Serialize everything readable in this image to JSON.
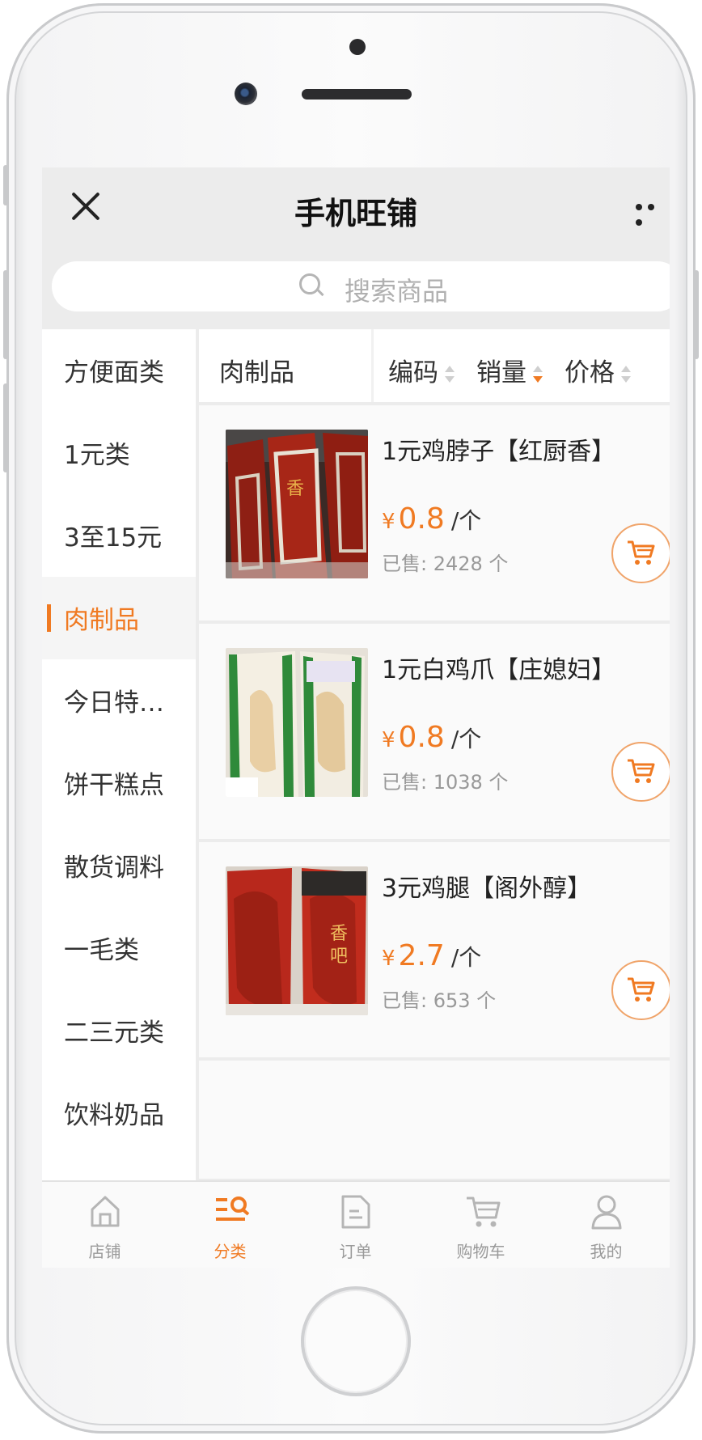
{
  "topbar": {
    "title": "手机旺铺"
  },
  "search": {
    "placeholder": "搜索商品"
  },
  "categories": [
    {
      "label": "方便面类",
      "active": false
    },
    {
      "label": "1元类",
      "active": false
    },
    {
      "label": "3至15元",
      "active": false
    },
    {
      "label": "肉制品",
      "active": true
    },
    {
      "label": "今日特…",
      "active": false
    },
    {
      "label": "饼干糕点",
      "active": false
    },
    {
      "label": "散货调料",
      "active": false
    },
    {
      "label": "一毛类",
      "active": false
    },
    {
      "label": "二三元类",
      "active": false
    },
    {
      "label": "饮料奶品",
      "active": false
    }
  ],
  "list_header": {
    "current_category": "肉制品",
    "sort": [
      {
        "label": "编码",
        "state": "none"
      },
      {
        "label": "销量",
        "state": "desc"
      },
      {
        "label": "价格",
        "state": "none"
      }
    ]
  },
  "products": [
    {
      "name": "1元鸡脖子【红厨香】",
      "currency": "¥",
      "price": "0.8",
      "unit": "/个",
      "sold": "已售: 2428 个"
    },
    {
      "name": "1元白鸡爪【庄媳妇】",
      "currency": "¥",
      "price": "0.8",
      "unit": "/个",
      "sold": "已售: 1038 个"
    },
    {
      "name": "3元鸡腿【阁外醇】",
      "currency": "¥",
      "price": "2.7",
      "unit": "/个",
      "sold": "已售: 653 个"
    }
  ],
  "tabs": [
    {
      "label": "店铺",
      "icon": "home-icon",
      "active": false
    },
    {
      "label": "分类",
      "icon": "category-icon",
      "active": true
    },
    {
      "label": "订单",
      "icon": "order-icon",
      "active": false
    },
    {
      "label": "购物车",
      "icon": "cart-icon",
      "active": false
    },
    {
      "label": "我的",
      "icon": "user-icon",
      "active": false
    }
  ],
  "colors": {
    "accent": "#f07a22",
    "text": "#333333",
    "muted": "#999999",
    "background": "#ececec"
  }
}
